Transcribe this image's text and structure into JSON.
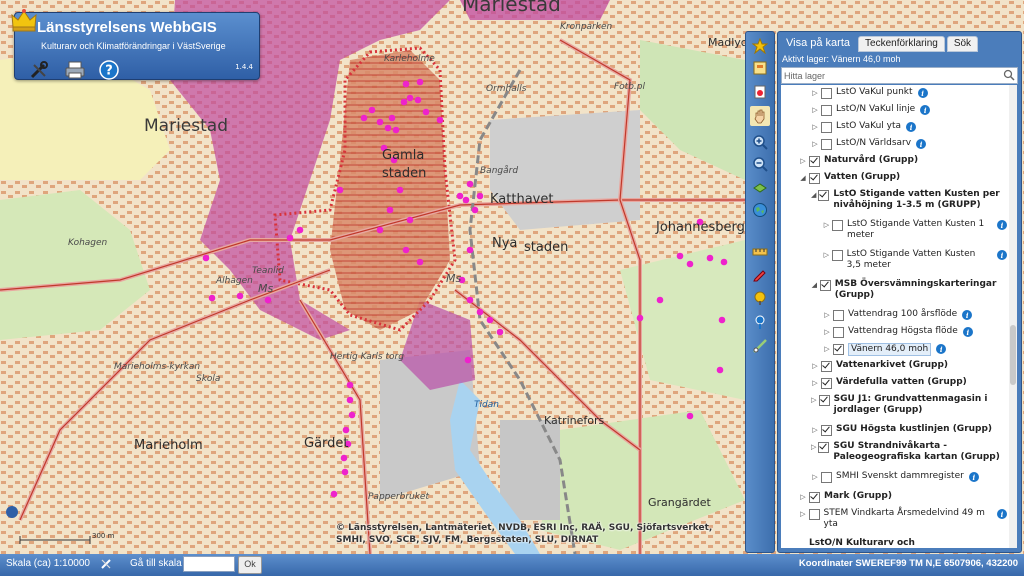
{
  "app": {
    "title": "Länsstyrelsens WebbGIS",
    "subtitle": "Kulturarv och Klimatförändringar i VästSverige",
    "version": "1.4.4",
    "tools": [
      "tools-icon",
      "print-icon",
      "help-icon"
    ]
  },
  "map": {
    "places_big": [
      "Mariestad",
      "Mariestad"
    ],
    "places_med": [
      "Gamla",
      "staden",
      "Katthavet",
      "Nya",
      "staden",
      "Johannesberg",
      "Gärdet",
      "Marieholm",
      "Katrinefors",
      "Grangärdet",
      "Madlyc",
      "Karleholme"
    ],
    "places_small": [
      "Kohagen",
      "Alhagen",
      "Marieholms-kyrkan",
      "Skola",
      "Papperbruket",
      "Bangård",
      "Teanlid",
      "Hertig Karls torg",
      "Ms",
      "Ms",
      "Tidan",
      "Kronparken",
      "Fotb.pl",
      "Ormhalls"
    ],
    "attribution": [
      "© Länsstyrelsen, Lantmäteriet, NVDB, ESRI Inc, RAÄ, SGU, Sjöfartsverket,",
      "SMHI, SVO, SCB, SJV, FM, Bergsstaten, SLU, DIRNAT"
    ],
    "scale_bar_label": "300 m",
    "colors": {
      "flood": "#c04aa0",
      "protected": "#d06a9a",
      "dots": "#ee22cc",
      "old_town": "#d8333a"
    }
  },
  "toolbar": {
    "buttons": [
      "favorites-star-icon",
      "layers-icon",
      "clear-icon",
      "pan-hand-icon",
      "zoom-in-icon",
      "zoom-out-icon",
      "full-extent-icon",
      "globe-icon",
      "measure-icon",
      "draw-icon",
      "identify-icon",
      "location-icon",
      "select-icon"
    ]
  },
  "panel": {
    "tabs": [
      "Visa på karta",
      "Teckenförklaring",
      "Sök"
    ],
    "active_layer": "Aktivt lager: Vänern 46,0 moh",
    "search_placeholder": "Hitta lager",
    "tree": [
      {
        "label": "LstO VaKul punkt",
        "checked": false,
        "info": true,
        "bold": false,
        "indent": 2,
        "arrow": "right"
      },
      {
        "label": "LstO/N VaKul linje",
        "checked": false,
        "info": true,
        "bold": false,
        "indent": 2,
        "arrow": "right"
      },
      {
        "label": "LstO VaKul yta",
        "checked": false,
        "info": true,
        "bold": false,
        "indent": 2,
        "arrow": "right"
      },
      {
        "label": "LstO/N Världsarv",
        "checked": false,
        "info": true,
        "bold": false,
        "indent": 2,
        "arrow": "right"
      },
      {
        "label": "Naturvård (Grupp)",
        "checked": true,
        "info": false,
        "bold": true,
        "indent": 1,
        "arrow": "right"
      },
      {
        "label": "Vatten (Grupp)",
        "checked": true,
        "info": false,
        "bold": true,
        "indent": 1,
        "arrow": "down"
      },
      {
        "label": "LstO Stigande vatten Kusten per nivåhöjning 1-3.5 m (GRUPP)",
        "checked": true,
        "info": false,
        "bold": true,
        "indent": 2,
        "arrow": "down"
      },
      {
        "label": "LstO Stigande Vatten Kusten 1 meter",
        "checked": false,
        "info": true,
        "bold": false,
        "indent": 3,
        "arrow": "right"
      },
      {
        "label": "LstO Stigande Vatten Kusten 3,5 meter",
        "checked": false,
        "info": true,
        "bold": false,
        "indent": 3,
        "arrow": "right"
      },
      {
        "label": "MSB Översvämningskarteringar (Grupp)",
        "checked": true,
        "info": false,
        "bold": true,
        "indent": 2,
        "arrow": "down"
      },
      {
        "label": "Vattendrag 100 årsflöde",
        "checked": false,
        "info": true,
        "bold": false,
        "indent": 3,
        "arrow": "right"
      },
      {
        "label": "Vattendrag Högsta flöde",
        "checked": false,
        "info": true,
        "bold": false,
        "indent": 3,
        "arrow": "right"
      },
      {
        "label": "Vänern 46,0 moh",
        "checked": true,
        "info": true,
        "bold": false,
        "indent": 3,
        "arrow": "right",
        "selected": true
      },
      {
        "label": "Vattenarkivet (Grupp)",
        "checked": true,
        "info": false,
        "bold": true,
        "indent": 2,
        "arrow": "right"
      },
      {
        "label": "Värdefulla vatten (Grupp)",
        "checked": true,
        "info": false,
        "bold": true,
        "indent": 2,
        "arrow": "right"
      },
      {
        "label": "SGU J1: Grundvattenmagasin i jordlager (Grupp)",
        "checked": true,
        "info": false,
        "bold": true,
        "indent": 2,
        "arrow": "right"
      },
      {
        "label": "SGU Högsta kustlinjen (Grupp)",
        "checked": true,
        "info": false,
        "bold": true,
        "indent": 2,
        "arrow": "right"
      },
      {
        "label": "SGU Strandnivåkarta - Paleogeografiska kartan (Grupp)",
        "checked": true,
        "info": false,
        "bold": true,
        "indent": 2,
        "arrow": "right"
      },
      {
        "label": "SMHI Svenskt dammregister",
        "checked": false,
        "info": true,
        "bold": false,
        "indent": 2,
        "arrow": "right"
      },
      {
        "label": "Mark (Grupp)",
        "checked": true,
        "info": false,
        "bold": true,
        "indent": 1,
        "arrow": "right"
      },
      {
        "label": "STEM Vindkarta Årsmedelvind 49 m yta",
        "checked": false,
        "info": true,
        "bold": false,
        "indent": 1,
        "arrow": "right"
      },
      {
        "label": "LstO/N Kulturarv och",
        "checked": false,
        "info": false,
        "bold": true,
        "indent": 1,
        "arrow": "none"
      }
    ]
  },
  "status": {
    "scale": "Skala (ca) 1:10000",
    "goto_scale": "Gå till skala",
    "ok": "Ok",
    "coordinates": "Koordinater SWEREF99 TM N,E 6507906, 432200"
  }
}
